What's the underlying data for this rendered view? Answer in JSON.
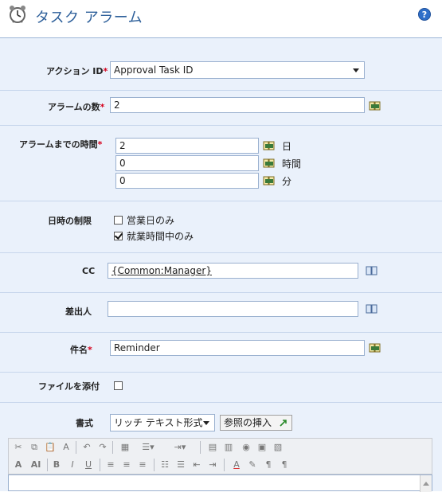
{
  "header": {
    "title": "タスク アラーム",
    "help_icon": "?"
  },
  "form": {
    "required_mark": "*",
    "action_id": {
      "label": "アクション ID",
      "value": "Approval Task ID"
    },
    "alarm_count": {
      "label": "アラームの数",
      "value": "2"
    },
    "time_until_alarm": {
      "label": "アラームまでの時間",
      "days": {
        "value": "2",
        "unit": "日"
      },
      "hours": {
        "value": "0",
        "unit": "時間"
      },
      "minutes": {
        "value": "0",
        "unit": "分"
      }
    },
    "time_restriction": {
      "label": "日時の制限",
      "business_days": {
        "label": "営業日のみ",
        "checked": false
      },
      "working_hours": {
        "label": "就業時間中のみ",
        "checked": true
      }
    },
    "cc": {
      "label": "CC",
      "value": "{Common:Manager}"
    },
    "sender": {
      "label": "差出人",
      "value": ""
    },
    "subject": {
      "label": "件名",
      "value": "Reminder"
    },
    "attach_file": {
      "label": "ファイルを添付",
      "checked": false
    },
    "format": {
      "label": "書式",
      "selected": "リッチ テキスト形式",
      "insert_reference": "参照の挿入"
    }
  },
  "toolbar_icons": [
    "cut-icon",
    "copy-icon",
    "paste-icon",
    "paste-text-icon",
    "undo-icon",
    "redo-icon",
    "table-icon",
    "list-style-icon",
    "indent-style-icon",
    "insert-table-icon",
    "table-props-icon",
    "image-icon",
    "picture-icon",
    "code-icon",
    "font-size-icon",
    "text-style-icon",
    "bold-icon",
    "italic-icon",
    "underline-icon",
    "align-left-icon",
    "align-center-icon",
    "align-right-icon",
    "ordered-list-icon",
    "unordered-list-icon",
    "outdent-icon",
    "indent-icon",
    "font-color-icon",
    "highlight-icon",
    "ltr-icon",
    "rtl-icon"
  ],
  "colors": {
    "title": "#2d5f9a",
    "form_bg": "#eaf1fb",
    "required": "#d6001c"
  }
}
